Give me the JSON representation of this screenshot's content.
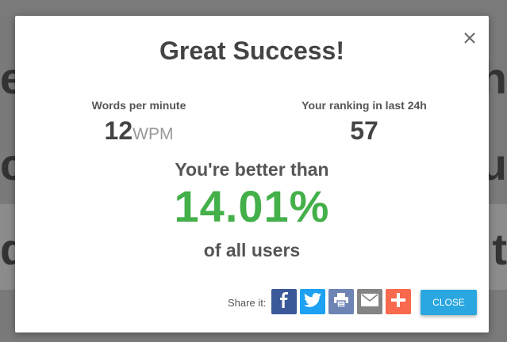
{
  "modal": {
    "title": "Great Success!",
    "stats": {
      "wpm_label": "Words per minute",
      "wpm_value": "12",
      "wpm_unit": "WPM",
      "rank_label": "Your ranking in last 24h",
      "rank_value": "57"
    },
    "better_than": "You're better than",
    "percent": "14.01%",
    "of_users": "of all users",
    "share_label": "Share it:",
    "share_buttons": [
      {
        "icon": "facebook-icon",
        "color": "#3b5998"
      },
      {
        "icon": "twitter-icon",
        "color": "#1da1f2"
      },
      {
        "icon": "print-icon",
        "color": "#6d84b4"
      },
      {
        "icon": "email-icon",
        "color": "#848484"
      },
      {
        "icon": "add-more-icon",
        "color": "#f8694d"
      }
    ],
    "close_label": "CLOSE"
  },
  "colors": {
    "accent_green": "#43b049",
    "close_button": "#2aa7e0"
  }
}
